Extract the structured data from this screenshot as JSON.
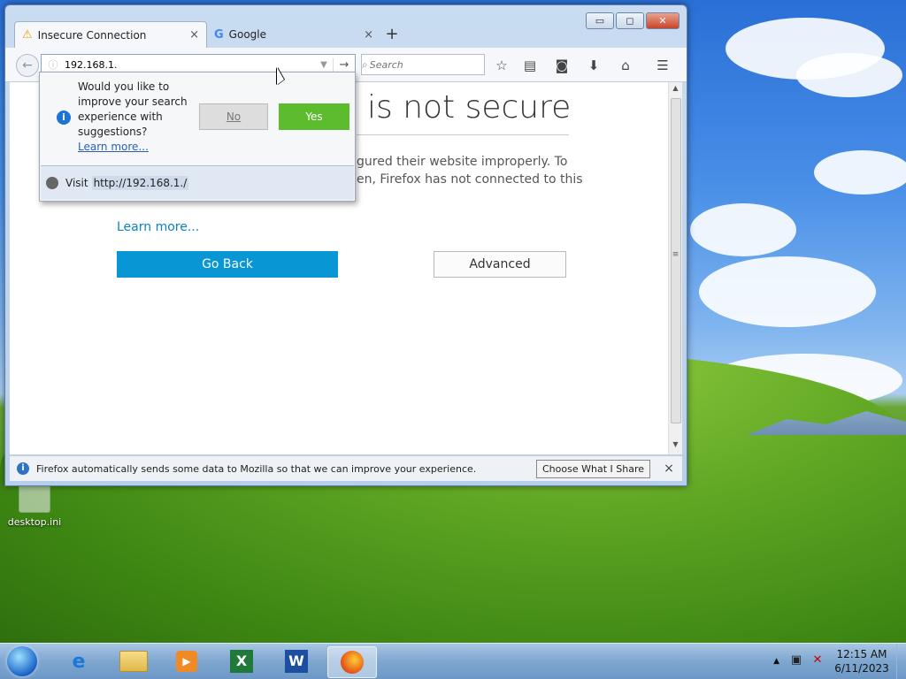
{
  "desktop": {
    "icon_label": "desktop.ini"
  },
  "window": {
    "tabs": [
      {
        "title": "Insecure Connection",
        "icon": "warning-icon",
        "close": "×"
      },
      {
        "title": "Google",
        "icon": "google-icon",
        "close": "×"
      }
    ],
    "new_tab": "+",
    "controls": {
      "minimize": "▭",
      "maximize": "◻",
      "close": "✕"
    }
  },
  "navbar": {
    "url_value": "192.168.1.",
    "search_placeholder": "Search",
    "go_glyph": "→",
    "back_glyph": "←"
  },
  "page": {
    "heading": "is not secure",
    "desc_line1": "gured their website improperly. To",
    "desc_line2": "en, Firefox has not connected to this",
    "learn_more": "Learn more...",
    "go_back": "Go Back",
    "advanced": "Advanced"
  },
  "popup": {
    "question": "Would you like to improve your search experience with suggestions?",
    "learn_more": "Learn more...",
    "no": "No",
    "yes": "Yes",
    "visit_label": "Visit",
    "visit_url": "http://192.168.1./"
  },
  "notification": {
    "message": "Firefox automatically sends some data to Mozilla so that we can improve your experience.",
    "button": "Choose What I Share",
    "close": "×"
  },
  "taskbar": {
    "apps": [
      "start-orb",
      "internet-explorer",
      "file-explorer",
      "media-player",
      "excel",
      "word",
      "firefox"
    ],
    "time": "12:15 AM",
    "date": "6/11/2023"
  },
  "colors": {
    "accent_blue": "#0996d5",
    "yes_green": "#5cbc2d",
    "link_blue": "#0a84c6"
  }
}
